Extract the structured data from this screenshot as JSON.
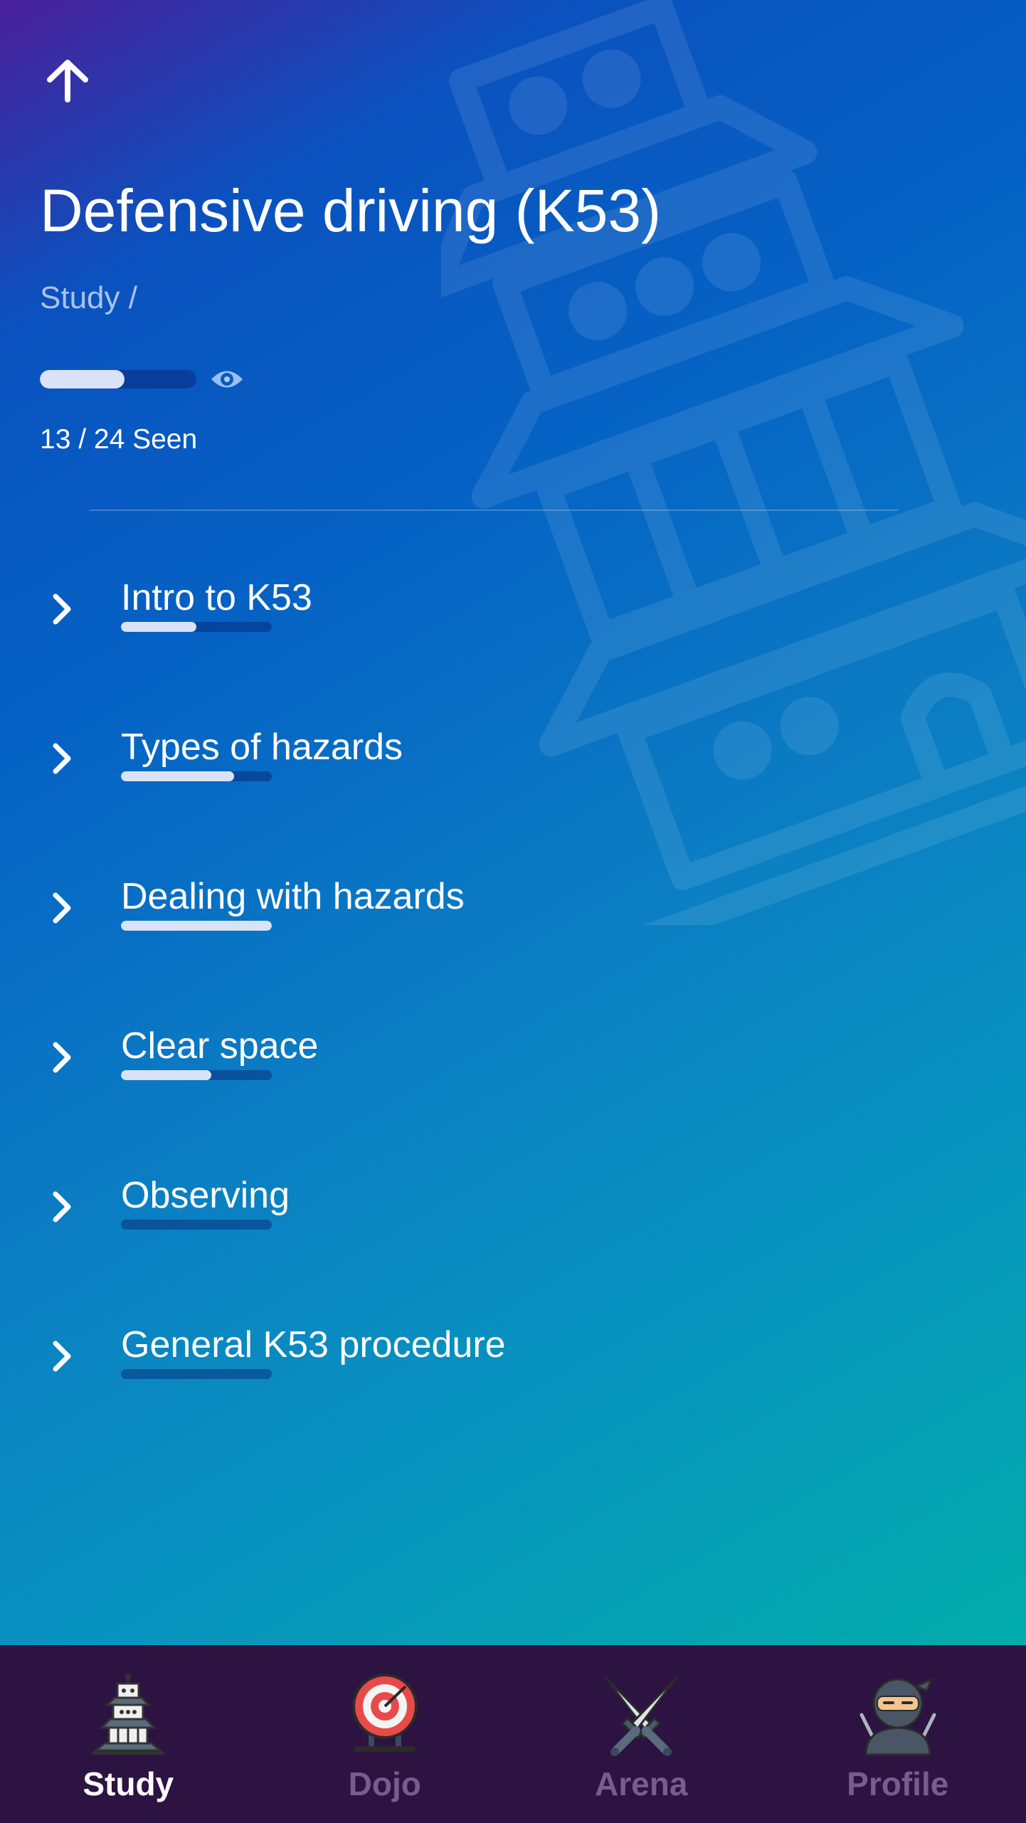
{
  "header": {
    "title": "Defensive driving (K53)",
    "breadcrumb": "Study /",
    "back_icon": "arrow-up-icon"
  },
  "overall_progress": {
    "fraction": 0.54,
    "seen_text": "13 / 24 Seen",
    "icon": "eye-icon"
  },
  "topics": [
    {
      "label": "Intro to K53",
      "progress": 0.5
    },
    {
      "label": "Types of hazards",
      "progress": 0.75
    },
    {
      "label": "Dealing with hazards",
      "progress": 1.0
    },
    {
      "label": "Clear space",
      "progress": 0.6
    },
    {
      "label": "Observing",
      "progress": 0.0
    },
    {
      "label": "General K53 procedure",
      "progress": 0.0
    }
  ],
  "bottom_nav": [
    {
      "label": "Study",
      "icon": "pagoda-icon",
      "active": true
    },
    {
      "label": "Dojo",
      "icon": "target-icon",
      "active": false
    },
    {
      "label": "Arena",
      "icon": "crossed-swords-icon",
      "active": false
    },
    {
      "label": "Profile",
      "icon": "ninja-icon",
      "active": false
    }
  ],
  "colors": {
    "progress_fill": "#d9e3f5",
    "nav_background": "#2c1342",
    "nav_inactive_label": "#7a5b8f"
  }
}
